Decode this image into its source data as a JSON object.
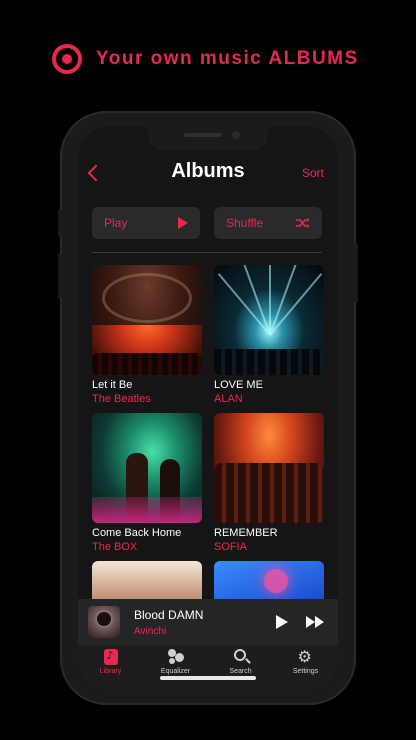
{
  "promo": {
    "headline": "Your own music ALBUMS",
    "icon": "record-icon"
  },
  "header": {
    "title": "Albums",
    "back_icon": "chevron-left-icon",
    "sort_label": "Sort"
  },
  "actions": {
    "play_label": "Play",
    "shuffle_label": "Shuffle"
  },
  "albums": [
    {
      "title": "Let it Be",
      "artist": "The Beatles"
    },
    {
      "title": "LOVE ME",
      "artist": "ALAN"
    },
    {
      "title": "Come Back Home",
      "artist": "The BOX"
    },
    {
      "title": "REMEMBER",
      "artist": "SOFIA"
    },
    {
      "title": "",
      "artist": ""
    },
    {
      "title": "",
      "artist": ""
    }
  ],
  "now_playing": {
    "title": "Blood DAMN",
    "artist": "Avinchi"
  },
  "tabs": [
    {
      "label": "Library",
      "icon": "music-note-icon",
      "active": true
    },
    {
      "label": "Equalizer",
      "icon": "equalizer-icon",
      "active": false
    },
    {
      "label": "Search",
      "icon": "search-icon",
      "active": false
    },
    {
      "label": "Settings",
      "icon": "gear-icon",
      "active": false
    }
  ],
  "colors": {
    "accent": "#e8294f",
    "background": "#000000",
    "surface": "#2a2a2d"
  }
}
